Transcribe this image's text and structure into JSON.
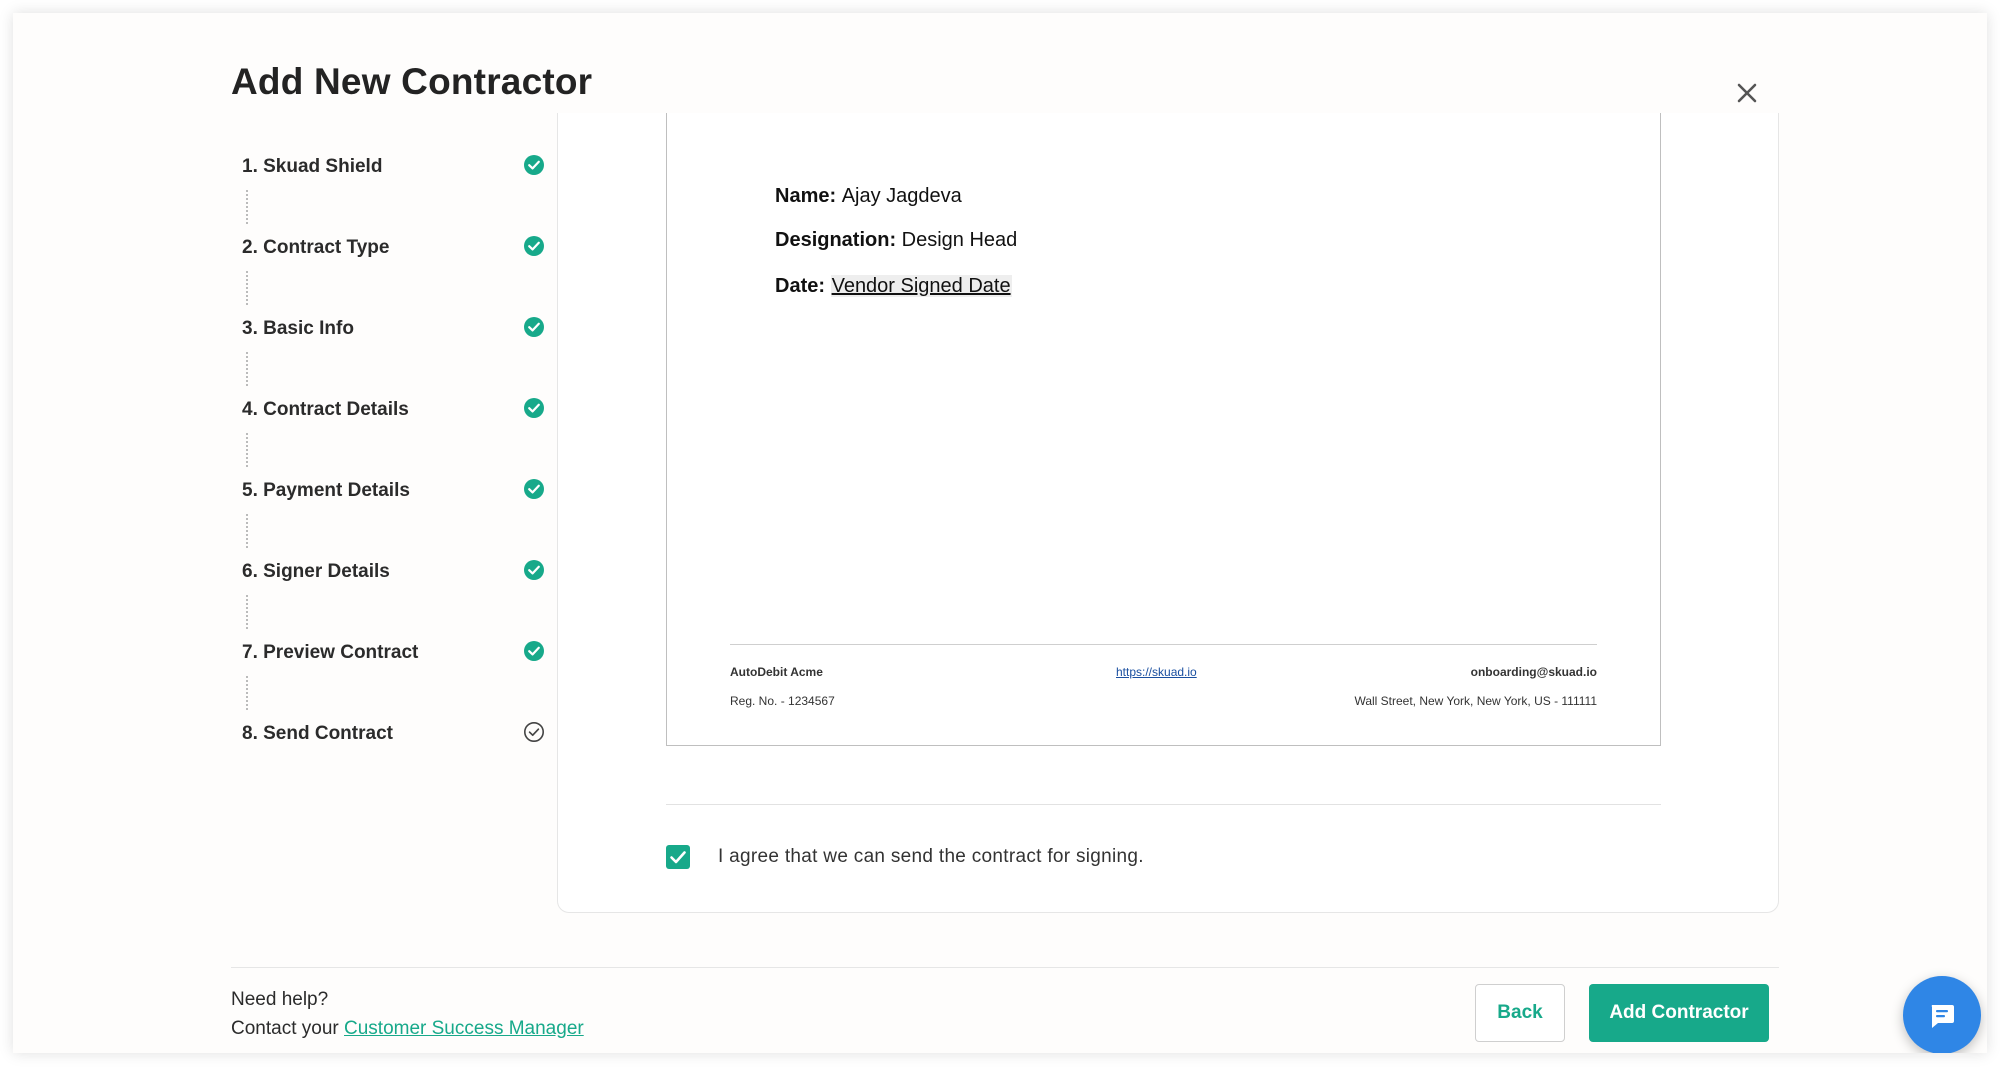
{
  "modal": {
    "title": "Add New Contractor"
  },
  "steps": [
    {
      "label": "1. Skuad Shield",
      "status": "complete"
    },
    {
      "label": "2. Contract Type",
      "status": "complete"
    },
    {
      "label": "3. Basic Info",
      "status": "complete"
    },
    {
      "label": "4. Contract Details",
      "status": "complete"
    },
    {
      "label": "5. Payment Details",
      "status": "complete"
    },
    {
      "label": "6. Signer Details",
      "status": "complete"
    },
    {
      "label": "7. Preview Contract",
      "status": "complete"
    },
    {
      "label": "8. Send Contract",
      "status": "current"
    }
  ],
  "document": {
    "name_label": "Name:",
    "name_value": "Ajay Jagdeva",
    "designation_label": "Designation:",
    "designation_value": "Design Head",
    "date_label": "Date:",
    "date_value": "Vendor Signed Date",
    "footer": {
      "company": "AutoDebit Acme",
      "reg_no": "Reg. No. - 1234567",
      "website": "https://skuad.io",
      "email": "onboarding@skuad.io",
      "address": "Wall Street, New York, New York, US - 111111"
    }
  },
  "agreement": {
    "text": "I agree that we can send the contract for signing.",
    "checked": true
  },
  "help": {
    "title": "Need help?",
    "contact_prefix": "Contact your",
    "contact_link": "Customer Success Manager"
  },
  "buttons": {
    "back": "Back",
    "add": "Add Contractor"
  },
  "colors": {
    "accent": "#17a98a",
    "chat": "#2f86e6"
  },
  "icons": {
    "close": "close-icon",
    "step_done": "check-circle-filled-icon",
    "step_current": "check-circle-outline-icon",
    "checkbox": "checkmark-icon",
    "chat": "chat-bubble-icon"
  }
}
